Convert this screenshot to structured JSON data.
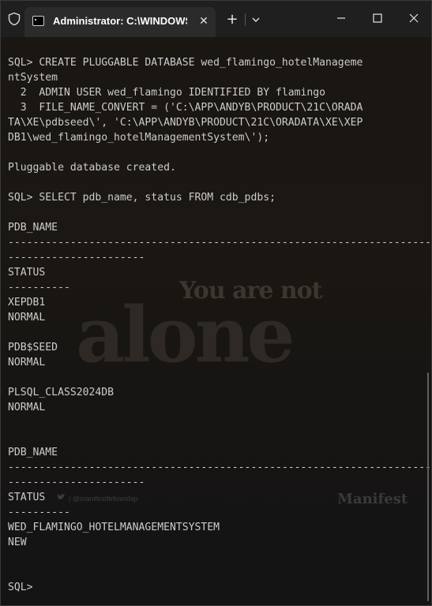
{
  "window": {
    "tab_title": "Administrator: C:\\WINDOWS\\",
    "tab_close_glyph": "✕",
    "new_tab_glyph": "+",
    "accent": "#ffffff"
  },
  "watermark": {
    "top": "You are not",
    "big": "alone",
    "social": "| @manifestfellowship",
    "brand": "Manifest"
  },
  "terminal": {
    "text_color": "#cccccc",
    "lines": [
      "SQL> CREATE PLUGGABLE DATABASE wed_flamingo_hotelManageme",
      "ntSystem",
      "  2  ADMIN USER wed_flamingo IDENTIFIED BY flamingo",
      "  3  FILE_NAME_CONVERT = ('C:\\APP\\ANDYB\\PRODUCT\\21C\\ORADA",
      "TA\\XE\\pdbseed\\', 'C:\\APP\\ANDYB\\PRODUCT\\21C\\ORADATA\\XE\\XEP",
      "DB1\\wed_flamingo_hotelManagementSystem\\');",
      "",
      "Pluggable database created.",
      "",
      "SQL> SELECT pdb_name, status FROM cdb_pdbs;",
      "",
      "PDB_NAME",
      "--------------------------------------------------------------------------------",
      "----------------------",
      "STATUS",
      "----------",
      "XEPDB1",
      "NORMAL",
      "",
      "PDB$SEED",
      "NORMAL",
      "",
      "PLSQL_CLASS2024DB",
      "NORMAL",
      "",
      "",
      "PDB_NAME",
      "--------------------------------------------------------------------------------",
      "----------------------",
      "STATUS",
      "----------",
      "WED_FLAMINGO_HOTELMANAGEMENTSYSTEM",
      "NEW",
      "",
      "",
      "SQL>"
    ]
  }
}
